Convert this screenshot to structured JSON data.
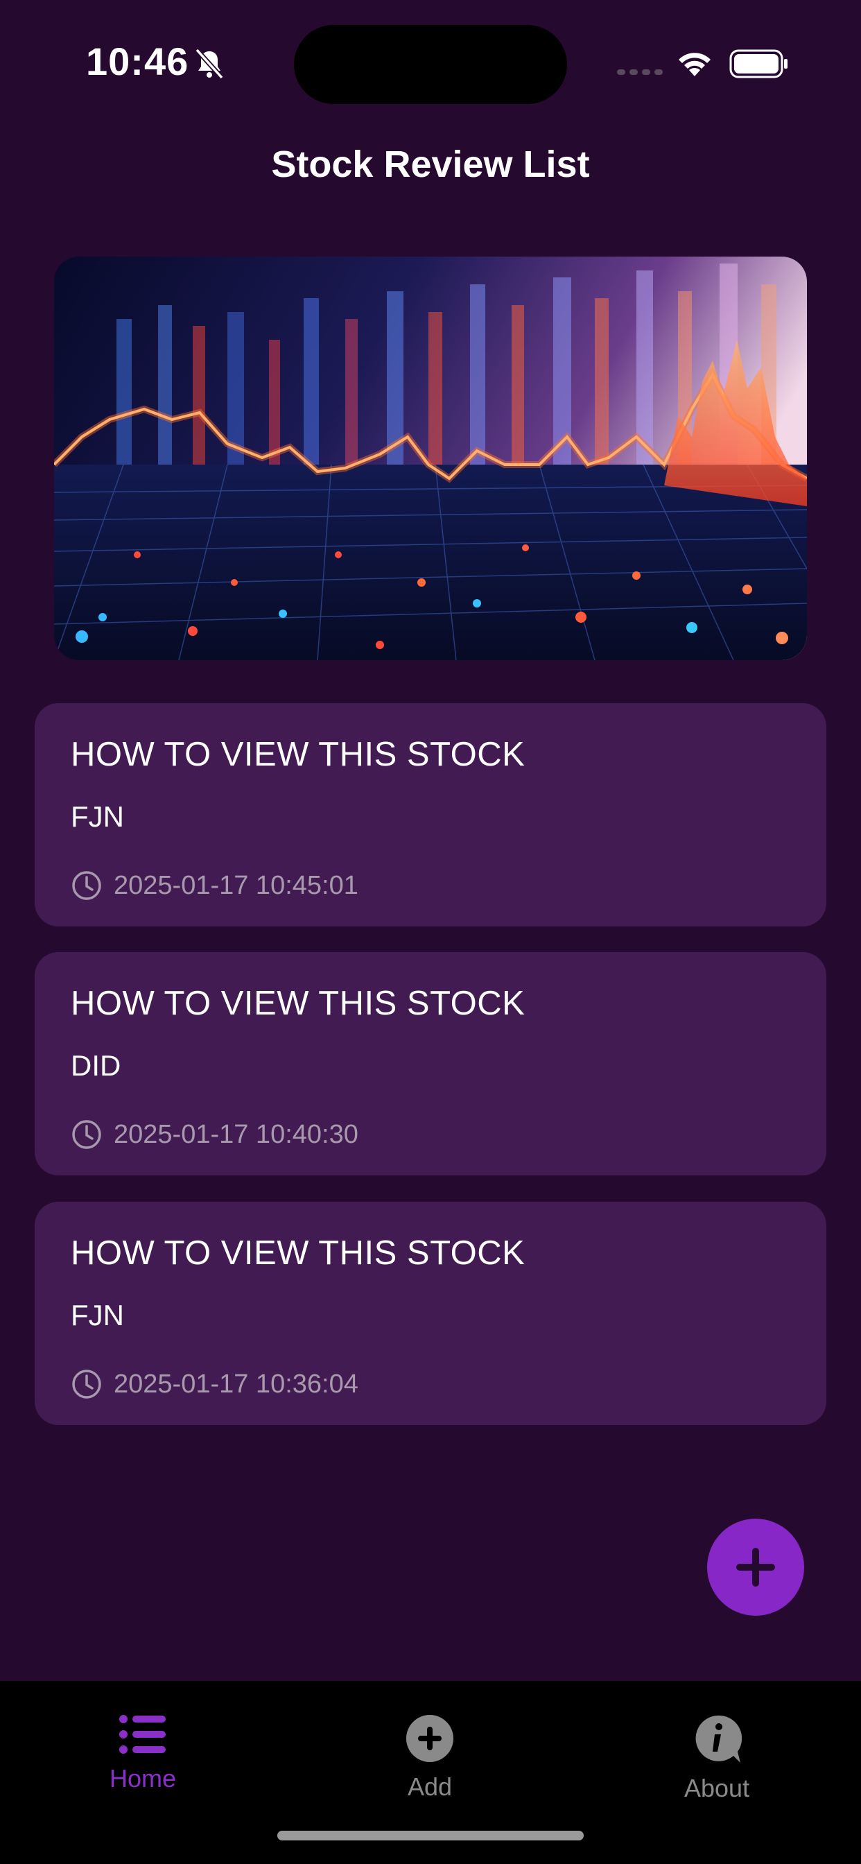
{
  "status_bar": {
    "time": "10:46"
  },
  "header": {
    "title": "Stock Review List"
  },
  "reviews": [
    {
      "title": "HOW TO VIEW THIS STOCK",
      "symbol": "FJN",
      "timestamp": "2025-01-17 10:45:01"
    },
    {
      "title": "HOW TO VIEW THIS STOCK",
      "symbol": "DID",
      "timestamp": "2025-01-17 10:40:30"
    },
    {
      "title": "HOW TO VIEW THIS STOCK",
      "symbol": "FJN",
      "timestamp": "2025-01-17 10:36:04"
    }
  ],
  "fab": {
    "icon": "plus-icon"
  },
  "bottom_nav": {
    "items": [
      {
        "label": "Home",
        "icon": "list-icon",
        "active": true
      },
      {
        "label": "Add",
        "icon": "add-circle-icon",
        "active": false
      },
      {
        "label": "About",
        "icon": "info-icon",
        "active": false
      }
    ]
  },
  "colors": {
    "background": "#26092f",
    "card": "#421b52",
    "accent": "#8727c8",
    "nav_active": "#8b2fc9",
    "nav_inactive": "#8a8a8a"
  }
}
